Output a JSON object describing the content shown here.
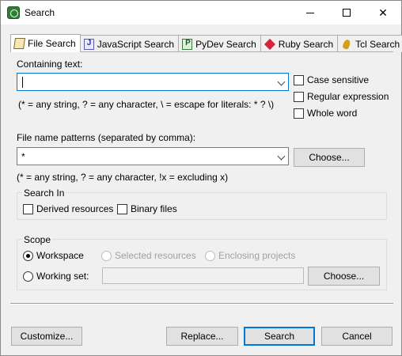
{
  "window": {
    "title": "Search"
  },
  "tabs": [
    {
      "label": "File Search",
      "active": true,
      "icon": "file-search-icon"
    },
    {
      "label": "JavaScript Search",
      "active": false,
      "icon": "javascript-search-icon"
    },
    {
      "label": "PyDev Search",
      "active": false,
      "icon": "pydev-search-icon"
    },
    {
      "label": "Ruby Search",
      "active": false,
      "icon": "ruby-search-icon"
    },
    {
      "label": "Tcl Search",
      "active": false,
      "icon": "tcl-search-icon"
    }
  ],
  "containing": {
    "label": "Containing text:",
    "value": "",
    "hint": "(* = any string, ? = any character, \\ = escape for literals: * ? \\)"
  },
  "options": {
    "case_sensitive": "Case sensitive",
    "regex": "Regular expression",
    "whole_word": "Whole word"
  },
  "patterns": {
    "label": "File name patterns (separated by comma):",
    "value": "*",
    "choose": "Choose...",
    "hint": "(* = any string, ? = any character, !x = excluding x)"
  },
  "search_in": {
    "title": "Search In",
    "derived": "Derived resources",
    "binary": "Binary files"
  },
  "scope": {
    "title": "Scope",
    "workspace": "Workspace",
    "selected": "Selected resources",
    "enclosing": "Enclosing projects",
    "working_set": "Working set:",
    "working_set_value": "",
    "choose": "Choose..."
  },
  "buttons": {
    "customize": "Customize...",
    "replace": "Replace...",
    "search": "Search",
    "cancel": "Cancel"
  },
  "colors": {
    "accent": "#0078d7",
    "background": "#f0f0f0"
  }
}
